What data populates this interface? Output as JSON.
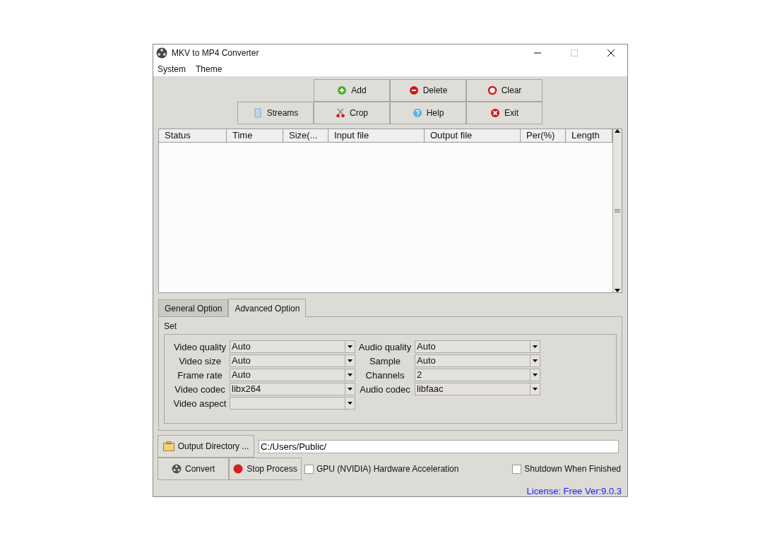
{
  "window": {
    "title": "MKV to MP4 Converter"
  },
  "menu": [
    "System",
    "Theme"
  ],
  "toolbar": {
    "buttons": [
      {
        "label": "Add",
        "kind": "plus"
      },
      {
        "label": "Delete",
        "kind": "minus"
      },
      {
        "label": "Clear",
        "kind": "ring"
      },
      {
        "label": "Streams",
        "kind": "book"
      },
      {
        "label": "Crop",
        "kind": "scissors"
      },
      {
        "label": "Help",
        "kind": "question"
      },
      {
        "label": "Exit",
        "kind": "cross"
      }
    ]
  },
  "table": {
    "columns": [
      "Status",
      "Time",
      "Size(...",
      "Input file",
      "Output file",
      "Per(%)",
      "Length"
    ]
  },
  "tabs": [
    {
      "label": "General Option",
      "selected": false
    },
    {
      "label": "Advanced Option",
      "selected": true
    }
  ],
  "options": {
    "title": "Set",
    "left": [
      {
        "label": "Video quality",
        "value": "Auto"
      },
      {
        "label": "Video size",
        "value": "Auto"
      },
      {
        "label": "Frame rate",
        "value": "Auto"
      },
      {
        "label": "Video codec",
        "value": "libx264"
      },
      {
        "label": "Video aspect"
      }
    ],
    "right": [
      {
        "label": "Audio quality",
        "value": "Auto"
      },
      {
        "label": "Sample",
        "value": "Auto"
      },
      {
        "label": "Channels",
        "value": "2"
      },
      {
        "label": "Audio codec",
        "value": "libfaac"
      }
    ]
  },
  "output": {
    "button": "Output Directory ...",
    "path": "C:/Users/Public/"
  },
  "actions": [
    {
      "label": "Convert",
      "kind": "reel"
    },
    {
      "label": "Stop Process",
      "kind": "stop"
    }
  ],
  "checks": [
    {
      "label": "GPU (NVIDIA) Hardware Acceleration",
      "checked": false
    },
    {
      "label": "Shutdown When Finished",
      "checked": false
    }
  ],
  "status": "License: Free Ver:9.0.3"
}
